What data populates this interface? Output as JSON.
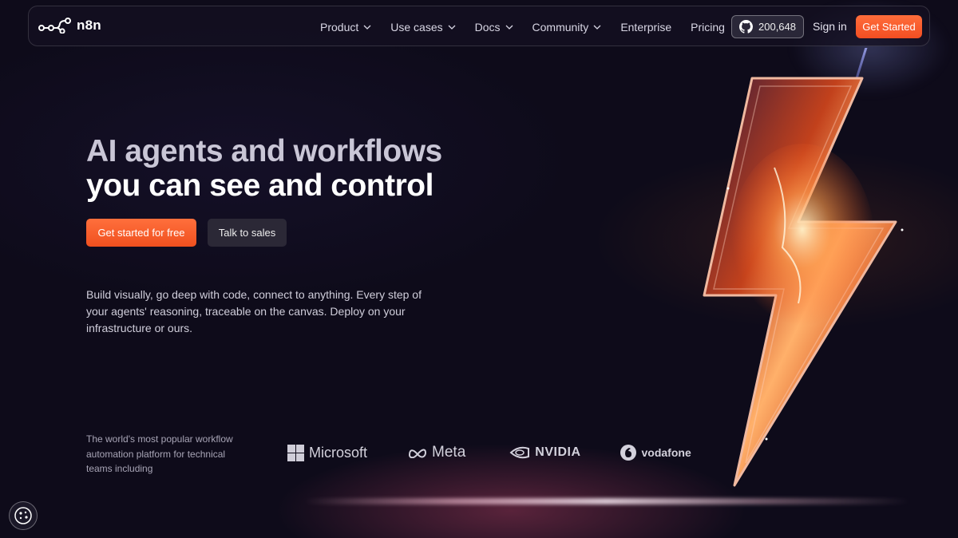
{
  "brand": {
    "name": "n8n",
    "accent": "#f24e22"
  },
  "nav": {
    "items": [
      {
        "label": "Product",
        "dropdown": true
      },
      {
        "label": "Use cases",
        "dropdown": true
      },
      {
        "label": "Docs",
        "dropdown": true
      },
      {
        "label": "Community",
        "dropdown": true
      },
      {
        "label": "Enterprise",
        "dropdown": false
      },
      {
        "label": "Pricing",
        "dropdown": false
      }
    ],
    "github_stars": "200,648",
    "signin_label": "Sign in",
    "cta_label": "Get Started"
  },
  "hero": {
    "title_line1": "AI agents and workflows",
    "title_line2": "you can see and control",
    "primary_cta": "Get started for free",
    "secondary_cta": "Talk to sales",
    "description": "Build visually, go deep with code, connect to anything. Every step of your agents' reasoning, traceable on the canvas. Deploy on your infrastructure or ours."
  },
  "social_proof": {
    "text": "The world's most popular workflow automation platform for technical teams including",
    "logos": [
      "Microsoft",
      "Meta",
      "NVIDIA",
      "vodafone"
    ]
  },
  "icons": [
    "n8n-logo-icon",
    "chevron-down-icon",
    "github-icon",
    "microsoft-logo-icon",
    "meta-logo-icon",
    "nvidia-logo-icon",
    "vodafone-logo-icon",
    "cookie-icon",
    "lightning-bolt-illustration"
  ]
}
